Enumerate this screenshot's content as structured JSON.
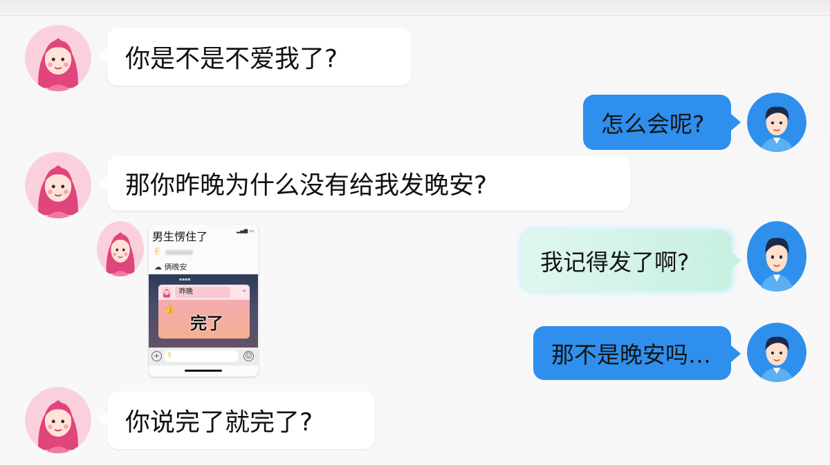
{
  "colors": {
    "blue_bubble": "#2f8fec",
    "white_bubble": "#ffffff",
    "green_bubble": "#c8f0e0",
    "background": "#f8f8f9"
  },
  "avatars": {
    "girl": "girl-avatar-icon",
    "boy": "boy-avatar-icon"
  },
  "messages": [
    {
      "side": "left",
      "text": "你是不是不爱我了?"
    },
    {
      "side": "right",
      "text": "怎么会呢?"
    },
    {
      "side": "left",
      "text": "那你昨晚为什么没有给我发晚安?"
    },
    {
      "side": "right",
      "text": "我记得发了啊?"
    },
    {
      "side": "right",
      "text": "那不是晚安吗…"
    },
    {
      "side": "left",
      "text": "你说完了就完了?"
    }
  ],
  "screenshot": {
    "title": "男生愣住了",
    "subtitle": "俩晚安",
    "chip_label": "昨晚",
    "overlay_text": "完了"
  }
}
